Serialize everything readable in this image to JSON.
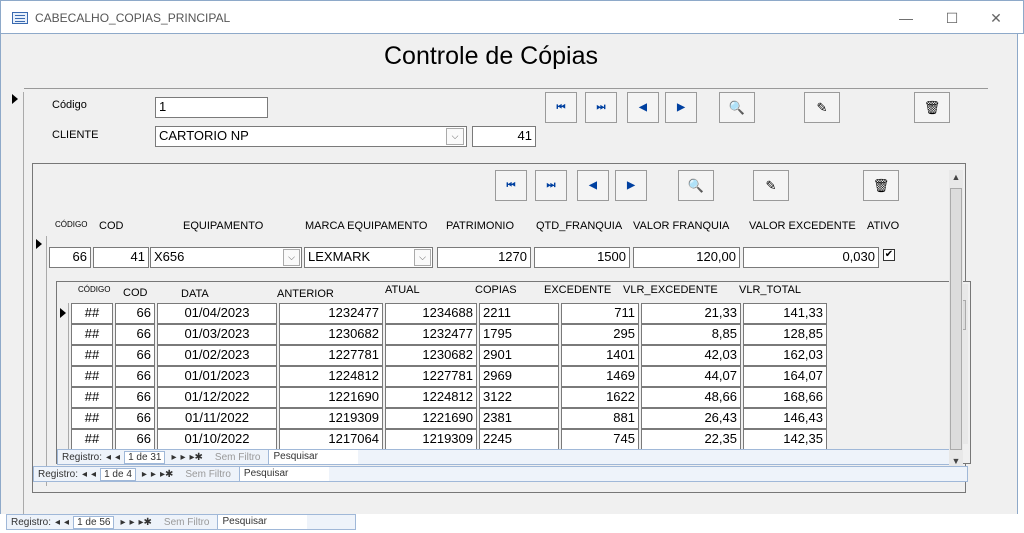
{
  "window": {
    "title": "CABECALHO_COPIAS_PRINCIPAL",
    "min": "—",
    "max": "☐",
    "close": "✕"
  },
  "form": {
    "title": "Controle de Cópias",
    "codigo_label": "Código",
    "codigo_value": "1",
    "cliente_label": "CLIENTE",
    "cliente_value": "CARTORIO NP",
    "cliente_id": "41"
  },
  "icons": {
    "first": "⏮",
    "last": "⏭",
    "prev": "◀",
    "next": "▶",
    "find": "🔍",
    "edit": "✎",
    "delete": "🗑"
  },
  "equip": {
    "headers": {
      "codigo": "CÓDIGO",
      "cod": "COD",
      "equipamento": "EQUIPAMENTO",
      "marca": "MARCA EQUIPAMENTO",
      "patrimonio": "PATRIMONIO",
      "qtd": "QTD_FRANQUIA",
      "valor_franquia": "VALOR FRANQUIA",
      "valor_excedente": "VALOR EXCEDENTE",
      "ativo": "ATIVO"
    },
    "row": {
      "codigo": "66",
      "cod": "41",
      "equipamento": "X656",
      "marca": "LEXMARK",
      "patrimonio": "1270",
      "qtd": "1500",
      "valor_franquia": "120,00",
      "valor_excedente": "0,030",
      "ativo": "✔"
    }
  },
  "leituras": {
    "headers": {
      "codigo": "CÓDIGO",
      "cod": "COD",
      "data": "DATA",
      "anterior": "ANTERIOR",
      "atual": "ATUAL",
      "copias": "COPIAS",
      "excedente": "EXCEDENTE",
      "vlr_excedente": "VLR_EXCEDENTE",
      "vlr_total": "VLR_TOTAL"
    },
    "rows": [
      {
        "codigo": "##",
        "cod": "66",
        "data": "01/04/2023",
        "anterior": "1232477",
        "atual": "1234688",
        "copias": "2211",
        "excedente": "711",
        "vlr_exc": "21,33",
        "vlr_total": "141,33"
      },
      {
        "codigo": "##",
        "cod": "66",
        "data": "01/03/2023",
        "anterior": "1230682",
        "atual": "1232477",
        "copias": "1795",
        "excedente": "295",
        "vlr_exc": "8,85",
        "vlr_total": "128,85"
      },
      {
        "codigo": "##",
        "cod": "66",
        "data": "01/02/2023",
        "anterior": "1227781",
        "atual": "1230682",
        "copias": "2901",
        "excedente": "1401",
        "vlr_exc": "42,03",
        "vlr_total": "162,03"
      },
      {
        "codigo": "##",
        "cod": "66",
        "data": "01/01/2023",
        "anterior": "1224812",
        "atual": "1227781",
        "copias": "2969",
        "excedente": "1469",
        "vlr_exc": "44,07",
        "vlr_total": "164,07"
      },
      {
        "codigo": "##",
        "cod": "66",
        "data": "01/12/2022",
        "anterior": "1221690",
        "atual": "1224812",
        "copias": "3122",
        "excedente": "1622",
        "vlr_exc": "48,66",
        "vlr_total": "168,66"
      },
      {
        "codigo": "##",
        "cod": "66",
        "data": "01/11/2022",
        "anterior": "1219309",
        "atual": "1221690",
        "copias": "2381",
        "excedente": "881",
        "vlr_exc": "26,43",
        "vlr_total": "146,43"
      },
      {
        "codigo": "##",
        "cod": "66",
        "data": "01/10/2022",
        "anterior": "1217064",
        "atual": "1219309",
        "copias": "2245",
        "excedente": "745",
        "vlr_exc": "22,35",
        "vlr_total": "142,35"
      }
    ]
  },
  "nav": {
    "label": "Registro:",
    "first": "◂",
    "prev": "◂",
    "next": "▸",
    "last": "▸",
    "new": "▸✱",
    "filter": "Sem Filtro",
    "search": "Pesquisar",
    "inner_pos": "1 de 31",
    "mid_pos": "1 de 4",
    "outer_pos": "1 de 56"
  }
}
